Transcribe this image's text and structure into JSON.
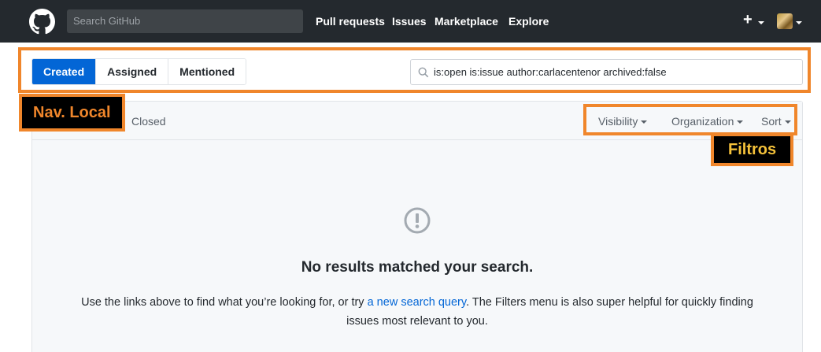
{
  "header": {
    "search_placeholder": "Search GitHub",
    "nav": [
      "Pull requests",
      "Issues",
      "Marketplace",
      "Explore"
    ],
    "plus": "+"
  },
  "tabs": [
    "Created",
    "Assigned",
    "Mentioned"
  ],
  "active_tab": "Created",
  "filter_query": "is:open is:issue author:carlacentenor archived:false",
  "states": {
    "closed": "Closed"
  },
  "filters": [
    "Visibility",
    "Organization",
    "Sort"
  ],
  "blankslate": {
    "title": "No results matched your search.",
    "text_before": "Use the links above to find what you’re looking for, or try ",
    "link": "a new search query",
    "text_after": ". The Filters menu is also super helpful for quickly finding issues most relevant to you."
  },
  "annotations": {
    "local_nav": "Nav. Local",
    "filters": "Filtros"
  },
  "colors": {
    "accent": "#0366d6",
    "annotation": "#f0862b",
    "header": "#24292e"
  }
}
